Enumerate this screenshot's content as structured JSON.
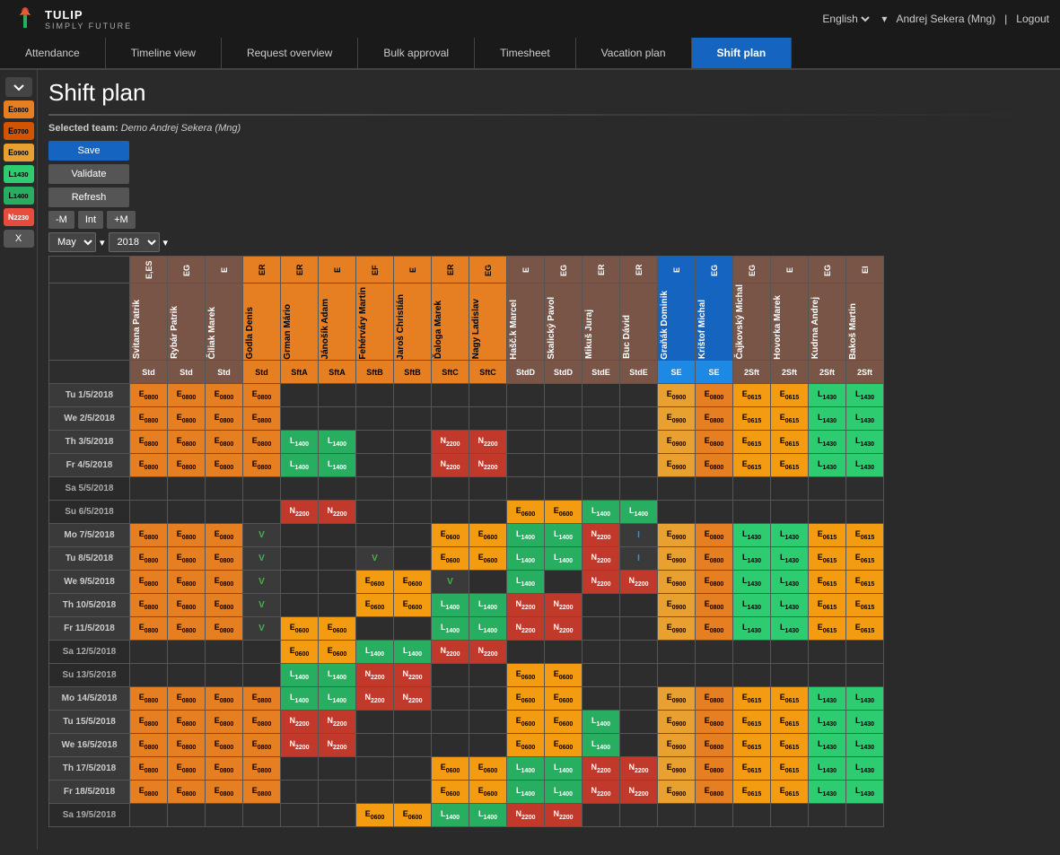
{
  "app": {
    "title": "TULIP | SIMPLY FUTURE",
    "logo_emoji": "🌷"
  },
  "topbar": {
    "language": "English",
    "user": "Andrej Sekera (Mng)",
    "logout_label": "Logout"
  },
  "nav": {
    "tabs": [
      {
        "id": "attendance",
        "label": "Attendance",
        "active": false
      },
      {
        "id": "timeline",
        "label": "Timeline view",
        "active": false
      },
      {
        "id": "request",
        "label": "Request overview",
        "active": false
      },
      {
        "id": "bulk",
        "label": "Bulk approval",
        "active": false
      },
      {
        "id": "timesheet",
        "label": "Timesheet",
        "active": false
      },
      {
        "id": "vacation",
        "label": "Vacation plan",
        "active": false
      },
      {
        "id": "shift",
        "label": "Shift plan",
        "active": true
      }
    ]
  },
  "page": {
    "title": "Shift plan",
    "selected_team_label": "Selected team:",
    "selected_team": "Demo Andrej Sekera (Mng)"
  },
  "controls": {
    "save_label": "Save",
    "validate_label": "Validate",
    "refresh_label": "Refresh",
    "minus_m": "-M",
    "int_label": "Int",
    "plus_m": "+M",
    "month": "May",
    "year": "2018"
  },
  "sidebar_badges": [
    {
      "id": "e0800",
      "label": "E₀₈₀₀",
      "class": "badge-e0800"
    },
    {
      "id": "e0700",
      "label": "E₀₇₀₀",
      "class": "badge-e0700"
    },
    {
      "id": "e0900",
      "label": "E₀₉₀₀",
      "class": "badge-e0900"
    },
    {
      "id": "l1430",
      "label": "L₁₄₃₀",
      "class": "badge-l1430"
    },
    {
      "id": "l1400",
      "label": "L₁₄₀₀",
      "class": "badge-l1400"
    },
    {
      "id": "n2230",
      "label": "N₂₂₃₀",
      "class": "badge-n2230"
    },
    {
      "id": "x",
      "label": "X",
      "class": "badge-x"
    }
  ],
  "employees": [
    {
      "name": "Svitana Patrik",
      "code": "E,ES",
      "std": "Std",
      "color": "brown"
    },
    {
      "name": "Rybár Patrik",
      "code": "EG",
      "std": "Std",
      "color": "brown"
    },
    {
      "name": "Čiliak Marek",
      "code": "E",
      "std": "Std",
      "color": "brown"
    },
    {
      "name": "Godla Denis",
      "code": "ER",
      "std": "Std",
      "color": "orange"
    },
    {
      "name": "Grman Mário",
      "code": "ER",
      "std": "SftA",
      "color": "orange"
    },
    {
      "name": "Jánošík Adam",
      "code": "E",
      "std": "SftA",
      "color": "orange"
    },
    {
      "name": "Fehérváry Martin",
      "code": "EF",
      "std": "SftB",
      "color": "orange"
    },
    {
      "name": "Jaroš Christián",
      "code": "E",
      "std": "SftB",
      "color": "orange"
    },
    {
      "name": "Ďaloga Marek",
      "code": "ER",
      "std": "SftC",
      "color": "orange"
    },
    {
      "name": "Nagy Ladislav",
      "code": "EG",
      "std": "SftC",
      "color": "orange"
    },
    {
      "name": "Hašč.k Marcel",
      "code": "E",
      "std": "StdD",
      "color": "brown"
    },
    {
      "name": "Skalický Pavol",
      "code": "EG",
      "std": "StdD",
      "color": "brown"
    },
    {
      "name": "Mikuš Juraj",
      "code": "ER",
      "std": "StdE",
      "color": "brown"
    },
    {
      "name": "Buc Dávid",
      "code": "ER",
      "std": "StdE",
      "color": "brown"
    },
    {
      "name": "Graňák Dominik",
      "code": "E",
      "std": "SE",
      "color": "blue"
    },
    {
      "name": "Krištof Michal",
      "code": "EG",
      "std": "SE",
      "color": "blue"
    },
    {
      "name": "Čajkovský Michal",
      "code": "EG",
      "std": "2Sft",
      "color": "brown"
    },
    {
      "name": "Hovorka Marek",
      "code": "E",
      "std": "2Sft",
      "color": "brown"
    },
    {
      "name": "Kudrna Andrej",
      "code": "EG",
      "std": "2Sft",
      "color": "brown"
    },
    {
      "name": "Bakoš Martin",
      "code": "EI",
      "std": "2Sft",
      "color": "brown"
    }
  ],
  "dates": [
    {
      "label": "Tu 1/5/2018",
      "weekend": false
    },
    {
      "label": "We 2/5/2018",
      "weekend": false
    },
    {
      "label": "Th 3/5/2018",
      "weekend": false
    },
    {
      "label": "Fr 4/5/2018",
      "weekend": false
    },
    {
      "label": "Sa 5/5/2018",
      "weekend": true
    },
    {
      "label": "Su 6/5/2018",
      "weekend": true
    },
    {
      "label": "Mo 7/5/2018",
      "weekend": false
    },
    {
      "label": "Tu 8/5/2018",
      "weekend": false
    },
    {
      "label": "We 9/5/2018",
      "weekend": false
    },
    {
      "label": "Th 10/5/2018",
      "weekend": false
    },
    {
      "label": "Fr 11/5/2018",
      "weekend": false
    },
    {
      "label": "Sa 12/5/2018",
      "weekend": true
    },
    {
      "label": "Su 13/5/2018",
      "weekend": true
    },
    {
      "label": "Mo 14/5/2018",
      "weekend": false
    },
    {
      "label": "Tu 15/5/2018",
      "weekend": false
    },
    {
      "label": "We 16/5/2018",
      "weekend": false
    },
    {
      "label": "Th 17/5/2018",
      "weekend": false
    },
    {
      "label": "Fr 18/5/2018",
      "weekend": false
    },
    {
      "label": "Sa 19/5/2018",
      "weekend": true
    }
  ]
}
